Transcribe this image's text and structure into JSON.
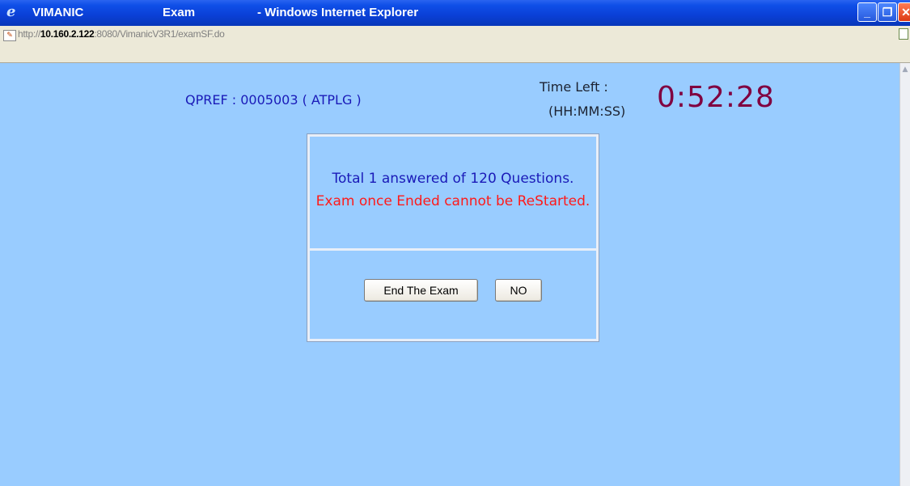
{
  "window": {
    "title_app": "VIMANIC",
    "title_page": "Exam",
    "title_browser": "- Windows Internet Explorer"
  },
  "address": {
    "scheme": "http://",
    "host": "10.160.2.122",
    "rest": ":8080/VimanicV3R1/examSF.do"
  },
  "exam": {
    "qpref": "QPREF : 0005003 ( ATPLG )",
    "time_left_label": "Time Left :",
    "time_format": "(HH:MM:SS)",
    "time_remaining": "0:52:28"
  },
  "dialog": {
    "answered_message": "Total 1 answered of 120 Questions.",
    "warning_message": "Exam once Ended cannot be ReStarted.",
    "end_button": "End The Exam",
    "no_button": "NO"
  },
  "colors": {
    "page_background": "#99ccff",
    "qpref": "#1a1ab8",
    "timer": "#800040",
    "warning": "#ff1a1a"
  },
  "icons": [
    "ie-logo-icon",
    "page-icon",
    "minimize-icon",
    "restore-icon",
    "close-icon",
    "rss-icon",
    "scroll-up-icon"
  ]
}
